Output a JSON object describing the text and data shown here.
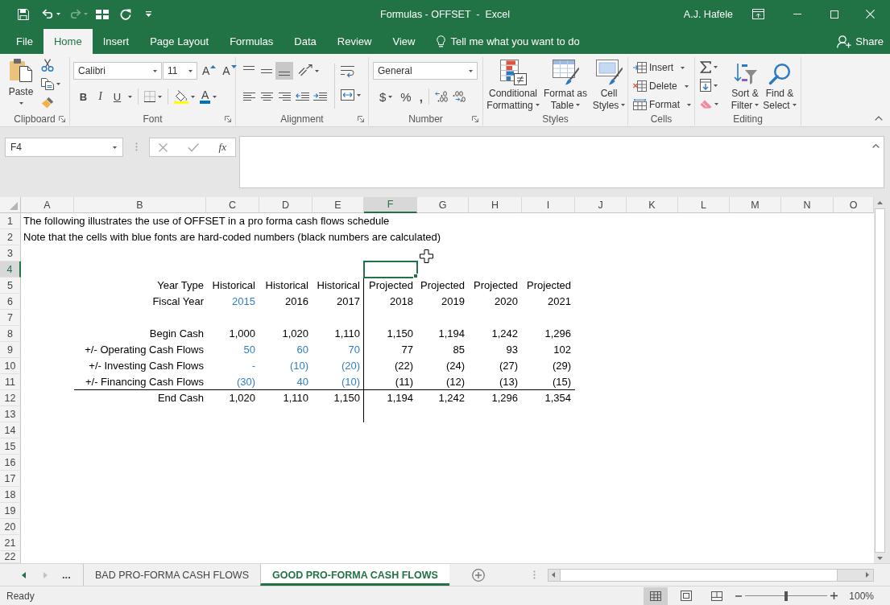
{
  "title_bar": {
    "title": "Formulas - OFFSET  -  Excel",
    "user": "A.J. Hafele"
  },
  "ribbon_tabs": [
    {
      "label": "File",
      "selected": false
    },
    {
      "label": "Home",
      "selected": true
    },
    {
      "label": "Insert",
      "selected": false
    },
    {
      "label": "Page Layout",
      "selected": false
    },
    {
      "label": "Formulas",
      "selected": false
    },
    {
      "label": "Data",
      "selected": false
    },
    {
      "label": "Review",
      "selected": false
    },
    {
      "label": "View",
      "selected": false
    }
  ],
  "tell_me": {
    "placeholder": "Tell me what you want to do"
  },
  "share": {
    "label": "Share"
  },
  "ribbon": {
    "clipboard": {
      "label": "Clipboard",
      "paste": "Paste"
    },
    "font": {
      "label": "Font",
      "font_name": "Calibri",
      "font_size": "11",
      "grow_font": "A",
      "shrink_font": "A",
      "style_buttons": [
        "B",
        "I",
        "U"
      ],
      "font_color": "A"
    },
    "alignment": {
      "label": "Alignment",
      "vertical_align": [
        {
          "selected": false
        },
        {
          "selected": false
        },
        {
          "selected": true
        }
      ]
    },
    "number": {
      "label": "Number",
      "format": "General",
      "buttons": [
        "$",
        "%",
        ","
      ]
    },
    "styles": {
      "label": "Styles",
      "buttons": [
        {
          "lines": [
            "Conditional",
            "Formatting"
          ]
        },
        {
          "lines": [
            "Format as",
            "Table"
          ]
        },
        {
          "lines": [
            "Cell",
            "Styles"
          ]
        }
      ]
    },
    "cells": {
      "label": "Cells",
      "buttons": [
        "Insert",
        "Delete",
        "Format"
      ]
    },
    "editing": {
      "label": "Editing",
      "buttons": [
        {
          "lines": [
            "Sort &",
            "Filter"
          ]
        },
        {
          "lines": [
            "Find &",
            "Select"
          ]
        }
      ]
    }
  },
  "formula_bar": {
    "name_box": "F4",
    "insert_function": "fx"
  },
  "sheet": {
    "columns": [
      {
        "label": "A",
        "selected": false
      },
      {
        "label": "B",
        "selected": false
      },
      {
        "label": "C",
        "selected": false
      },
      {
        "label": "D",
        "selected": false
      },
      {
        "label": "E",
        "selected": false
      },
      {
        "label": "F",
        "selected": true
      },
      {
        "label": "G",
        "selected": false
      },
      {
        "label": "H",
        "selected": false
      },
      {
        "label": "I",
        "selected": false
      },
      {
        "label": "J",
        "selected": false
      },
      {
        "label": "K",
        "selected": false
      },
      {
        "label": "L",
        "selected": false
      },
      {
        "label": "M",
        "selected": false
      },
      {
        "label": "N",
        "selected": false
      },
      {
        "label": "O",
        "selected": false
      }
    ],
    "rows": [
      {
        "number": "1",
        "selected": false,
        "note": "The following illustrates the use of OFFSET in a pro forma cash flows schedule"
      },
      {
        "number": "2",
        "selected": false,
        "note": "Note that the cells with blue fonts are hard-coded numbers (black numbers are calculated)"
      },
      {
        "number": "3",
        "selected": false
      },
      {
        "number": "4",
        "selected": true
      },
      {
        "number": "5",
        "selected": false,
        "label": "Year Type",
        "values": [
          {
            "text": "Historical",
            "hard_coded": false
          },
          {
            "text": "Historical",
            "hard_coded": false
          },
          {
            "text": "Historical",
            "hard_coded": false
          },
          {
            "text": "Projected",
            "hard_coded": false
          },
          {
            "text": "Projected",
            "hard_coded": false
          },
          {
            "text": "Projected",
            "hard_coded": false
          },
          {
            "text": "Projected",
            "hard_coded": false
          }
        ]
      },
      {
        "number": "6",
        "selected": false,
        "label": "Fiscal Year",
        "values": [
          {
            "text": "2015",
            "hard_coded": true
          },
          {
            "text": "2016",
            "hard_coded": false
          },
          {
            "text": "2017",
            "hard_coded": false
          },
          {
            "text": "2018",
            "hard_coded": false
          },
          {
            "text": "2019",
            "hard_coded": false
          },
          {
            "text": "2020",
            "hard_coded": false
          },
          {
            "text": "2021",
            "hard_coded": false
          }
        ]
      },
      {
        "number": "7",
        "selected": false
      },
      {
        "number": "8",
        "selected": false,
        "label": "Begin Cash",
        "values": [
          {
            "text": "1,000",
            "hard_coded": false
          },
          {
            "text": "1,020",
            "hard_coded": false
          },
          {
            "text": "1,110",
            "hard_coded": false
          },
          {
            "text": "1,150",
            "hard_coded": false
          },
          {
            "text": "1,194",
            "hard_coded": false
          },
          {
            "text": "1,242",
            "hard_coded": false
          },
          {
            "text": "1,296",
            "hard_coded": false
          }
        ]
      },
      {
        "number": "9",
        "selected": false,
        "label": "+/- Operating Cash Flows",
        "values": [
          {
            "text": "50",
            "hard_coded": true
          },
          {
            "text": "60",
            "hard_coded": true
          },
          {
            "text": "70",
            "hard_coded": true
          },
          {
            "text": "77",
            "hard_coded": false
          },
          {
            "text": "85",
            "hard_coded": false
          },
          {
            "text": "93",
            "hard_coded": false
          },
          {
            "text": "102",
            "hard_coded": false
          }
        ]
      },
      {
        "number": "10",
        "selected": false,
        "label": "+/- Investing Cash Flows",
        "values": [
          {
            "text": "-",
            "hard_coded": true
          },
          {
            "text": "(10)",
            "hard_coded": true
          },
          {
            "text": "(20)",
            "hard_coded": true
          },
          {
            "text": "(22)",
            "hard_coded": false
          },
          {
            "text": "(24)",
            "hard_coded": false
          },
          {
            "text": "(27)",
            "hard_coded": false
          },
          {
            "text": "(29)",
            "hard_coded": false
          }
        ]
      },
      {
        "number": "11",
        "selected": false,
        "label": "+/- Financing Cash Flows",
        "values": [
          {
            "text": "(30)",
            "hard_coded": true
          },
          {
            "text": "40",
            "hard_coded": true
          },
          {
            "text": "(10)",
            "hard_coded": true
          },
          {
            "text": "(11)",
            "hard_coded": false
          },
          {
            "text": "(12)",
            "hard_coded": false
          },
          {
            "text": "(13)",
            "hard_coded": false
          },
          {
            "text": "(15)",
            "hard_coded": false
          }
        ]
      },
      {
        "number": "12",
        "selected": false,
        "label": "End Cash",
        "values": [
          {
            "text": "1,020",
            "hard_coded": false
          },
          {
            "text": "1,110",
            "hard_coded": false
          },
          {
            "text": "1,150",
            "hard_coded": false
          },
          {
            "text": "1,194",
            "hard_coded": false
          },
          {
            "text": "1,242",
            "hard_coded": false
          },
          {
            "text": "1,296",
            "hard_coded": false
          },
          {
            "text": "1,354",
            "hard_coded": false
          }
        ]
      },
      {
        "number": "13",
        "selected": false
      },
      {
        "number": "14",
        "selected": false
      },
      {
        "number": "15",
        "selected": false
      },
      {
        "number": "16",
        "selected": false
      },
      {
        "number": "17",
        "selected": false
      },
      {
        "number": "18",
        "selected": false
      },
      {
        "number": "19",
        "selected": false
      },
      {
        "number": "20",
        "selected": false
      },
      {
        "number": "21",
        "selected": false
      },
      {
        "number": "22",
        "selected": false
      }
    ]
  },
  "sheet_tabs_bar": {
    "more": "...",
    "tabs": [
      {
        "label": "BAD PRO-FORMA CASH FLOWS",
        "selected": false
      },
      {
        "label": "GOOD PRO-FORMA CASH FLOWS",
        "selected": true
      }
    ]
  },
  "status_bar": {
    "status": "Ready",
    "view_buttons": [
      {
        "selected": true
      },
      {
        "selected": false
      },
      {
        "selected": false
      }
    ],
    "zoom": {
      "level": 0.5,
      "reading": "100%"
    }
  }
}
